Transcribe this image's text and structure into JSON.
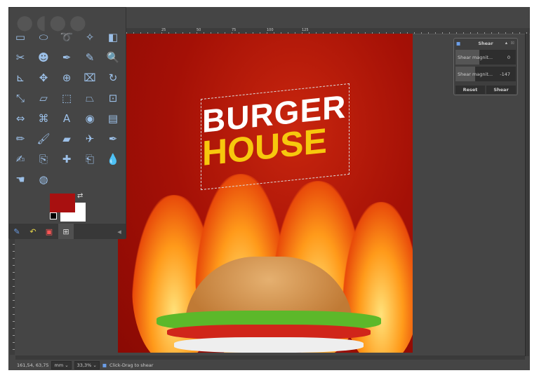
{
  "ruler": {
    "labels": [
      "25",
      "50",
      "75",
      "100",
      "125"
    ]
  },
  "canvas": {
    "headline": "BURGER",
    "subhead": "HOUSE"
  },
  "toolbox": {
    "active_tool": "shear-tool",
    "fg_color": "#a81010",
    "bg_color": "#ffffff",
    "tools": [
      "rect-select",
      "ellipse-select",
      "free-select",
      "fuzzy-select",
      "select-by-color",
      "scissors-select",
      "foreground-select",
      "paths",
      "color-picker",
      "zoom",
      "measure",
      "move",
      "align",
      "crop",
      "transform",
      "rotate",
      "scale",
      "shear",
      "perspective",
      "unified-transform",
      "flip",
      "cage",
      "text",
      "bucket-fill",
      "blend",
      "pencil",
      "paintbrush",
      "eraser",
      "airbrush",
      "ink",
      "mypaint-brush",
      "clone",
      "heal",
      "perspective-clone",
      "blur",
      "smudge",
      "dodge-burn"
    ],
    "tabs": [
      "tool-options",
      "undo-history",
      "images",
      "device-status"
    ]
  },
  "shear_dialog": {
    "title": "Shear",
    "field1_label": "Shear magnit...",
    "field1_value": "0",
    "field2_label": "Shear magnit...",
    "field2_value": "-147",
    "reset": "Reset",
    "shear": "Shear"
  },
  "status": {
    "coords": "161,54, 63,75",
    "unit": "mm",
    "zoom": "33,3%",
    "message": "Click-Drag to shear"
  }
}
